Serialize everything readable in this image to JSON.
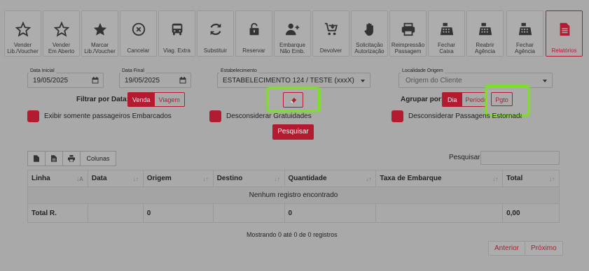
{
  "toolbar": [
    {
      "label": "Vender\nLib./Voucher",
      "icon": "star-outline-icon"
    },
    {
      "label": "Vender\nEm Aberto",
      "icon": "star-outline-icon"
    },
    {
      "label": "Marcar\nLib./Voucher",
      "icon": "star-filled-icon"
    },
    {
      "label": "Cancelar",
      "icon": "circle-x-icon"
    },
    {
      "label": "Viag. Extra",
      "icon": "bus-icon"
    },
    {
      "label": "Substituir",
      "icon": "refresh-icon"
    },
    {
      "label": "Reservar",
      "icon": "unlock-icon"
    },
    {
      "label": "Embarque\nNão Emb.",
      "icon": "user-plus-icon"
    },
    {
      "label": "Devolver",
      "icon": "cart-down-icon"
    },
    {
      "label": "Solicitação\nAutorização",
      "icon": "hand-icon"
    },
    {
      "label": "Reimpressão\nPassagem",
      "icon": "printer-icon"
    },
    {
      "label": "Fechar\nCaixa",
      "icon": "register-icon"
    },
    {
      "label": "Reabrir\nAgência",
      "icon": "register-icon"
    },
    {
      "label": "Fechar\nAgência",
      "icon": "register-icon"
    },
    {
      "label": "Relatórios",
      "icon": "document-icon",
      "active": true
    }
  ],
  "filters": {
    "data_inicial": {
      "label": "Data Inicial",
      "value": "19/05/2025"
    },
    "data_final": {
      "label": "Data Final",
      "value": "19/05/2025"
    },
    "estabelecimento": {
      "label": "Estabelecimento",
      "value": "ESTABELECIMENTO 124 / TESTE (xxxX)"
    },
    "localidade": {
      "label": "Localidade Origem",
      "placeholder": "Origem do Cliente"
    },
    "filtrar_por": {
      "label": "Filtrar por Data:",
      "options": [
        "Venda",
        "Viagem"
      ],
      "selected": "Venda"
    },
    "agrupar_por": {
      "label": "Agrupar por:",
      "options": [
        "Dia",
        "Período",
        "Pgto"
      ],
      "selected": "Dia"
    },
    "checkboxes": [
      "Exibir somente passageiros Embarcados",
      "Desconsiderar Gratuidades",
      "Desconsiderar Passagens Estornadas"
    ],
    "pesquisar_button": "Pesquisar"
  },
  "table_toolbar": {
    "colunas": "Colunas",
    "search_label": "Pesquisar"
  },
  "table": {
    "columns": [
      "Linha",
      "Data",
      "Origem",
      "Destino",
      "Quantidade",
      "Taxa de Embarque",
      "Total"
    ],
    "empty_message": "Nenhum registro encontrado",
    "total_row": [
      "Total R.",
      "",
      "0",
      "",
      "0",
      "",
      "0,00"
    ]
  },
  "footer": {
    "info": "Mostrando 0 até 0 de 0 registros",
    "prev": "Anterior",
    "next": "Próximo"
  },
  "colors": {
    "accent": "#b31b31",
    "highlight": "#7be21f"
  }
}
